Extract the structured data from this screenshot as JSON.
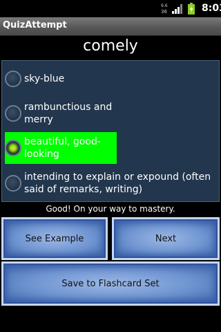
{
  "status": {
    "network": "36",
    "time": "8:03"
  },
  "app": {
    "title": "QuizAttempt"
  },
  "quiz": {
    "word": "comely",
    "options": [
      {
        "label": "sky-blue",
        "selected": false
      },
      {
        "label": "rambunctious and merry",
        "selected": false
      },
      {
        "label": "beautiful, good-looking",
        "selected": true
      },
      {
        "label": "intending to explain or expound (often said of remarks, writing)",
        "selected": false
      }
    ],
    "feedback": "Good! On your way to mastery."
  },
  "buttons": {
    "see_example": "See Example",
    "next": "Next",
    "save_flashcard": "Save to Flashcard Set"
  },
  "colors": {
    "selected_bg": "#00ff00",
    "options_bg": "#22364d"
  },
  "icons": [
    "signal-icon",
    "battery-icon",
    "network-type-icon"
  ]
}
